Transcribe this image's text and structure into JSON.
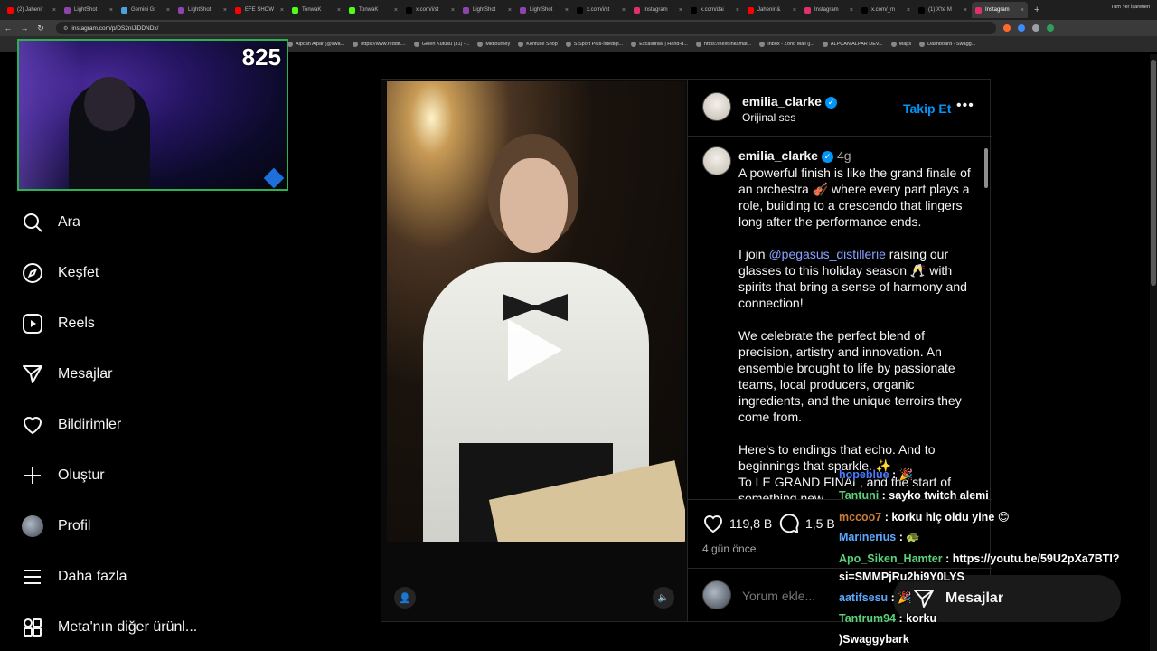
{
  "browser": {
    "tabs": [
      {
        "label": "(2) Jahenir",
        "color": "#ff0000"
      },
      {
        "label": "LightShot",
        "color": "#8e44ad"
      },
      {
        "label": "Gemini Gr",
        "color": "#4aa3df"
      },
      {
        "label": "LightShot",
        "color": "#8e44ad"
      },
      {
        "label": "EFE SHOW",
        "color": "#ff0000"
      },
      {
        "label": "TonwaK",
        "color": "#53fc18"
      },
      {
        "label": "TonwaK",
        "color": "#53fc18"
      },
      {
        "label": "x.com/i/st",
        "color": "#000000"
      },
      {
        "label": "LightShot",
        "color": "#8e44ad"
      },
      {
        "label": "LightShot",
        "color": "#8e44ad"
      },
      {
        "label": "x.com/i/st",
        "color": "#000000"
      },
      {
        "label": "Instagram",
        "color": "#e1306c"
      },
      {
        "label": "x.com/dai",
        "color": "#000000"
      },
      {
        "label": "Jahenir &",
        "color": "#ff0000"
      },
      {
        "label": "Instagram",
        "color": "#e1306c"
      },
      {
        "label": "x.com/_m",
        "color": "#000000"
      },
      {
        "label": "(1) X'te M",
        "color": "#000000"
      },
      {
        "label": "Instagram",
        "color": "#e1306c",
        "active": true
      }
    ],
    "url": "instagram.com/p/DS2nlJiDDNDx/",
    "bookmarks": [
      "Alpcan Alpar (@swa...",
      "https://www.reddit....",
      "Gelen Kutusu (31) -...",
      "Midjourney",
      "Konfuse Shop",
      "S Sport Plus-İstediği...",
      "Excalidraw | Hand-d...",
      "https://next.inkamat...",
      "Inbox - Zoho Mail (j...",
      "ALPCAN ALPAR DEV...",
      "Maps",
      "Dashboard - Swagg..."
    ],
    "all_bookmarks": "Tüm Yer İşaretleri"
  },
  "webcam": {
    "counter": "825"
  },
  "sidebar": {
    "items": [
      {
        "label": "Ara",
        "icon": "search-icon"
      },
      {
        "label": "Keşfet",
        "icon": "compass-icon"
      },
      {
        "label": "Reels",
        "icon": "reels-icon"
      },
      {
        "label": "Mesajlar",
        "icon": "paper-plane-icon"
      },
      {
        "label": "Bildirimler",
        "icon": "heart-icon"
      },
      {
        "label": "Oluştur",
        "icon": "plus-icon"
      },
      {
        "label": "Profil",
        "icon": "avatar"
      },
      {
        "label": "Daha fazla",
        "icon": "menu-icon"
      },
      {
        "label": "Meta'nın diğer ürünl...",
        "icon": "grid-icon"
      }
    ]
  },
  "post": {
    "username": "emilia_clarke",
    "audio": "Orijinal ses",
    "follow_label": "Takip Et",
    "more_label": "•••",
    "caption": {
      "username": "emilia_clarke",
      "time": "4g",
      "p1": "A powerful finish is like the grand finale of an orchestra 🎻 where every part plays a role, building to a crescendo that lingers long after the performance ends.",
      "p2_pre": "I join ",
      "p2_mention": "@pegasus_distillerie",
      "p2_post": " raising our glasses to this holiday season 🥂 with spirits that bring a sense of harmony and connection!",
      "p3": "We celebrate the perfect blend of precision, artistry and innovation. An ensemble brought to life by passionate teams, local producers, organic ingredients, and the unique terroirs they come from.",
      "p4a": "Here's to endings that echo. And to beginnings that sparkle. ✨",
      "p4b": "To LE GRAND FINAL, and the start of something new..."
    },
    "likes": "119,8 B",
    "comments": "1,5 B",
    "date_ago": "4 gün önce",
    "comment_placeholder": "Yorum ekle..."
  },
  "chat": [
    {
      "user": "hopeblue",
      "user_color": "#4a7cff",
      "text": " : 🎉"
    },
    {
      "user": "Tantuni",
      "user_color": "#5ad17a",
      "text": " : sayko twitch alemi"
    },
    {
      "user": "mccoo7",
      "user_color": "#c97b3a",
      "text": " : korku hiç oldu yine 😊"
    },
    {
      "user": "Marinerius",
      "user_color": "#5aa9ff",
      "text": " : 🐢"
    },
    {
      "user": "Apo_Siken_Hamter",
      "user_color": "#5ad17a",
      "text": " : https://youtu.be/59U2pXa7BTI?"
    },
    {
      "user": "",
      "user_color": "#ffffff",
      "text": "si=SMMPjRu2hi9Y0LYS"
    },
    {
      "user": "aatifsesu",
      "user_color": "#5aa9ff",
      "text": " : 🎉"
    },
    {
      "user": "Tantrum94",
      "user_color": "#5ad17a",
      "text": " : korku"
    },
    {
      "user": "",
      "user_color": "#ffffff",
      "text": ")Swaggybark"
    }
  ],
  "messages_bar": {
    "label": "Mesajlar"
  }
}
